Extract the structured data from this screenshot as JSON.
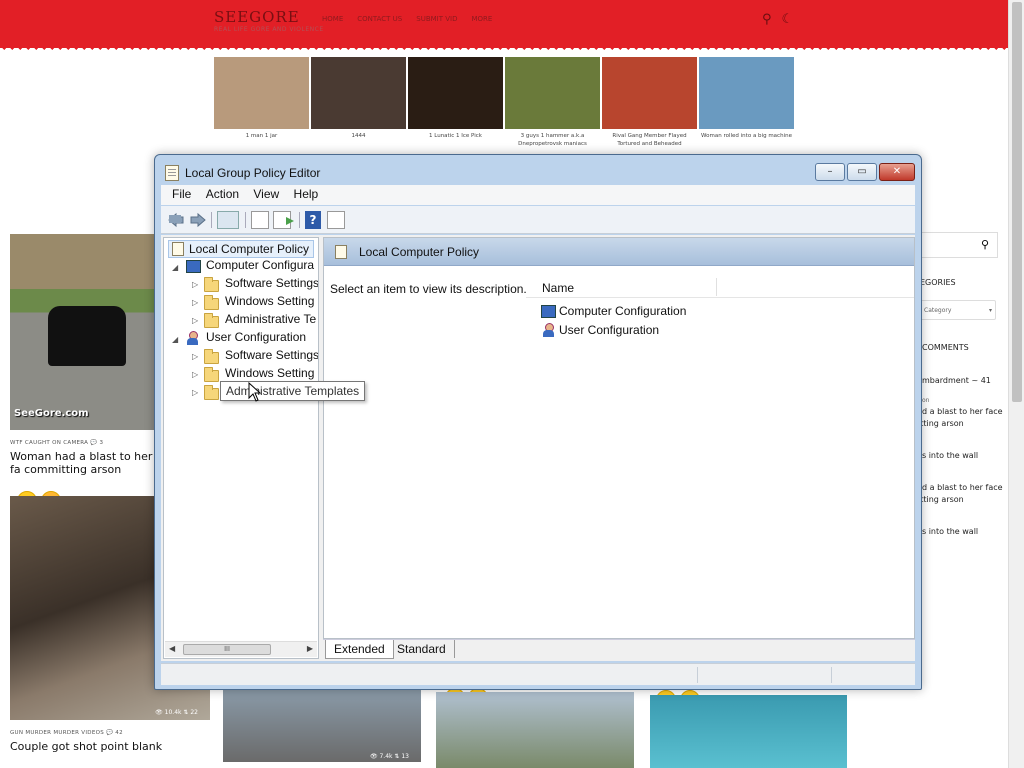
{
  "site": {
    "logo": "SEEGORE",
    "tagline": "REAL LIFE GORE AND VIOLENCE",
    "nav": [
      "HOME",
      "CONTACT US",
      "SUBMIT VID",
      "MORE"
    ],
    "thumbnails": [
      {
        "caption": "1 man 1 jar",
        "color": "#b89a7c"
      },
      {
        "caption": "1444",
        "color": "#4a3a32"
      },
      {
        "caption": "1 Lunatic 1 Ice Pick",
        "color": "#2a1d14"
      },
      {
        "caption": "3 guys 1 hammer a.k.a Dnepropetrovsk maniacs",
        "color": "#6a7a3a"
      },
      {
        "caption": "Rival Gang Member Flayed Tortured and Beheaded",
        "color": "#b8452e"
      },
      {
        "caption": "Woman rolled into a big machine",
        "color": "#6a9ac0"
      }
    ],
    "posts": [
      {
        "tags": "WTF   CAUGHT ON CAMERA",
        "comments": "3",
        "title": "Woman had a blast to her fa committing arson"
      },
      {
        "tags": "GUN   MURDER   MURDER VIDEOS",
        "comments": "42",
        "title": "Couple got shot point blank",
        "views": "10.4k",
        "shares": "22"
      },
      {
        "views": "7.4k",
        "shares": "13"
      }
    ],
    "watermark": "SeeGore.com",
    "sidebar": {
      "categories_heading": "EGORIES",
      "category_placeholder": "Category",
      "comments_heading": "COMMENTS",
      "comments": [
        "mbardment ~ 41",
        "on",
        "d a blast to her face",
        "itting arson",
        "s into the wall",
        "d a blast to her face",
        "itting arson",
        "s into the wall"
      ]
    }
  },
  "window": {
    "title": "Local Group Policy Editor",
    "buttons": {
      "minimize": "–",
      "maximize": "▭",
      "close": "✕"
    },
    "menu": [
      "File",
      "Action",
      "View",
      "Help"
    ],
    "tree": {
      "root": "Local Computer Policy",
      "computer": "Computer Configura",
      "computer_children": [
        "Software Settings",
        "Windows Setting",
        "Administrative Te"
      ],
      "user": "User Configuration",
      "user_children": [
        "Software Settings",
        "Windows Setting",
        "Administrative Templates"
      ]
    },
    "scroll_thumb": "III",
    "tooltip": "Administrative Templates",
    "right_pane": {
      "header": "Local Computer Policy",
      "description": "Select an item to view its description.",
      "column": "Name",
      "items": [
        "Computer Configuration",
        "User Configuration"
      ]
    },
    "tabs": [
      "Extended",
      "Standard"
    ]
  }
}
